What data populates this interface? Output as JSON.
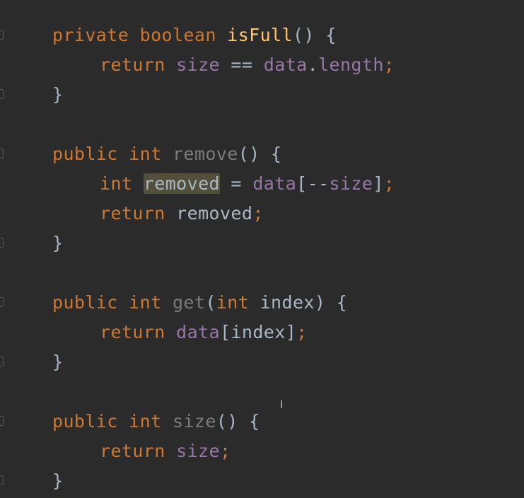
{
  "editor": {
    "theme_colors": {
      "background": "#2b2b2b",
      "keyword": "#cc7832",
      "function": "#ffc66d",
      "unused_function": "#7a7a7a",
      "field": "#9876aa",
      "text": "#a9b7c6",
      "highlight": "#52503a"
    },
    "lines": {
      "l1": {
        "kw1": "private",
        "kw2": "boolean",
        "name": "isFull",
        "rest": "() {"
      },
      "l2": {
        "kw": "return",
        "f1": "size",
        "op": " == ",
        "f2": "data",
        "dot": ".",
        "f3": "length",
        "semi": ";"
      },
      "l3": {
        "brace": "}"
      },
      "l4": {
        "kw1": "public",
        "kw2": "int",
        "name": "remove",
        "rest": "() {"
      },
      "l5": {
        "kw": "int",
        "var": "removed",
        "op": " = ",
        "f1": "data",
        "b1": "[--",
        "f2": "size",
        "b2": "]",
        "semi": ";"
      },
      "l6": {
        "kw": "return",
        "var": "removed",
        "semi": ";"
      },
      "l7": {
        "brace": "}"
      },
      "l8": {
        "kw1": "public",
        "kw2": "int",
        "name": "get",
        "p1": "(",
        "kw3": "int",
        "param": "index",
        "rest": ") {"
      },
      "l9": {
        "kw": "return",
        "f1": "data",
        "b1": "[",
        "var": "index",
        "b2": "]",
        "semi": ";"
      },
      "l10": {
        "brace": "}"
      },
      "l11": {
        "kw1": "public",
        "kw2": "int",
        "name": "size",
        "rest": "() {"
      },
      "l12": {
        "kw": "return",
        "f1": "size",
        "semi": ";"
      },
      "l13": {
        "brace": "}"
      }
    },
    "cursor_glyph": "I"
  }
}
